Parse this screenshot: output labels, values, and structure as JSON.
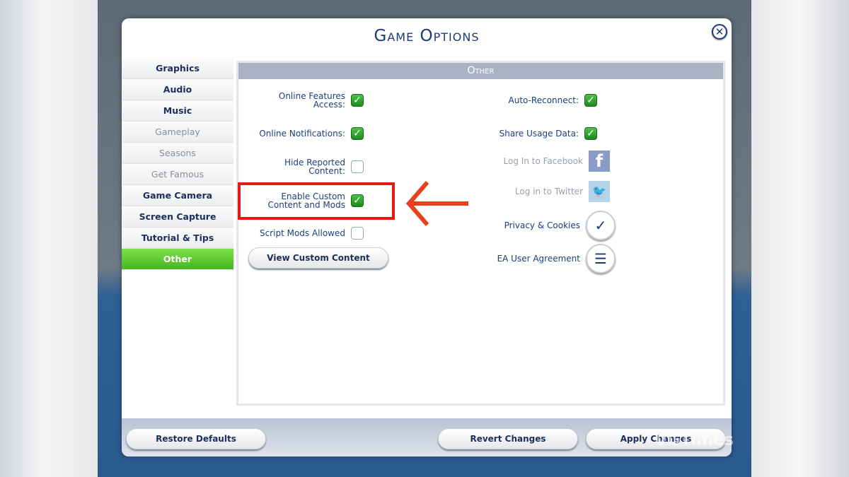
{
  "dialog": {
    "title": "Game Options",
    "close_label": "✕"
  },
  "sidebar": {
    "items": [
      {
        "label": "Graphics",
        "state": "enabled"
      },
      {
        "label": "Audio",
        "state": "enabled"
      },
      {
        "label": "Music",
        "state": "enabled"
      },
      {
        "label": "Gameplay",
        "state": "disabled"
      },
      {
        "label": "Seasons",
        "state": "disabled"
      },
      {
        "label": "Get Famous",
        "state": "disabled"
      },
      {
        "label": "Game Camera",
        "state": "enabled"
      },
      {
        "label": "Screen Capture",
        "state": "enabled"
      },
      {
        "label": "Tutorial & Tips",
        "state": "enabled"
      },
      {
        "label": "Other",
        "state": "active"
      }
    ]
  },
  "panel": {
    "header": "Other",
    "left": [
      {
        "label1": "Online Features",
        "label2": "Access:",
        "checked": true
      },
      {
        "label1": "Online Notifications:",
        "label2": "",
        "checked": true
      },
      {
        "label1": "Hide Reported",
        "label2": "Content:",
        "checked": false
      },
      {
        "label1": "Enable Custom",
        "label2": "Content and Mods",
        "checked": true
      },
      {
        "label1": "Script Mods Allowed",
        "label2": "",
        "checked": false
      }
    ],
    "view_custom_content": "View Custom Content",
    "right": [
      {
        "label": "Auto-Reconnect:",
        "checked": true
      },
      {
        "label": "Share Usage Data:",
        "checked": true
      }
    ],
    "facebook": {
      "label": "Log In to Facebook",
      "icon": "f"
    },
    "twitter": {
      "label": "Log in to Twitter",
      "icon": "🐦"
    },
    "privacy": {
      "label": "Privacy & Cookies",
      "icon": "✓"
    },
    "agreement": {
      "label": "EA User Agreement",
      "icon": "☰"
    }
  },
  "annotation": {
    "arrow_color": "#e8401c",
    "box_color": "#e41b12"
  },
  "footer": {
    "restore": "Restore Defaults",
    "revert": "Revert Changes",
    "apply": "Apply Changes"
  },
  "watermark": "VGTimes",
  "colors": {
    "accent_green": "#45b61e",
    "navy": "#1b3a78"
  }
}
